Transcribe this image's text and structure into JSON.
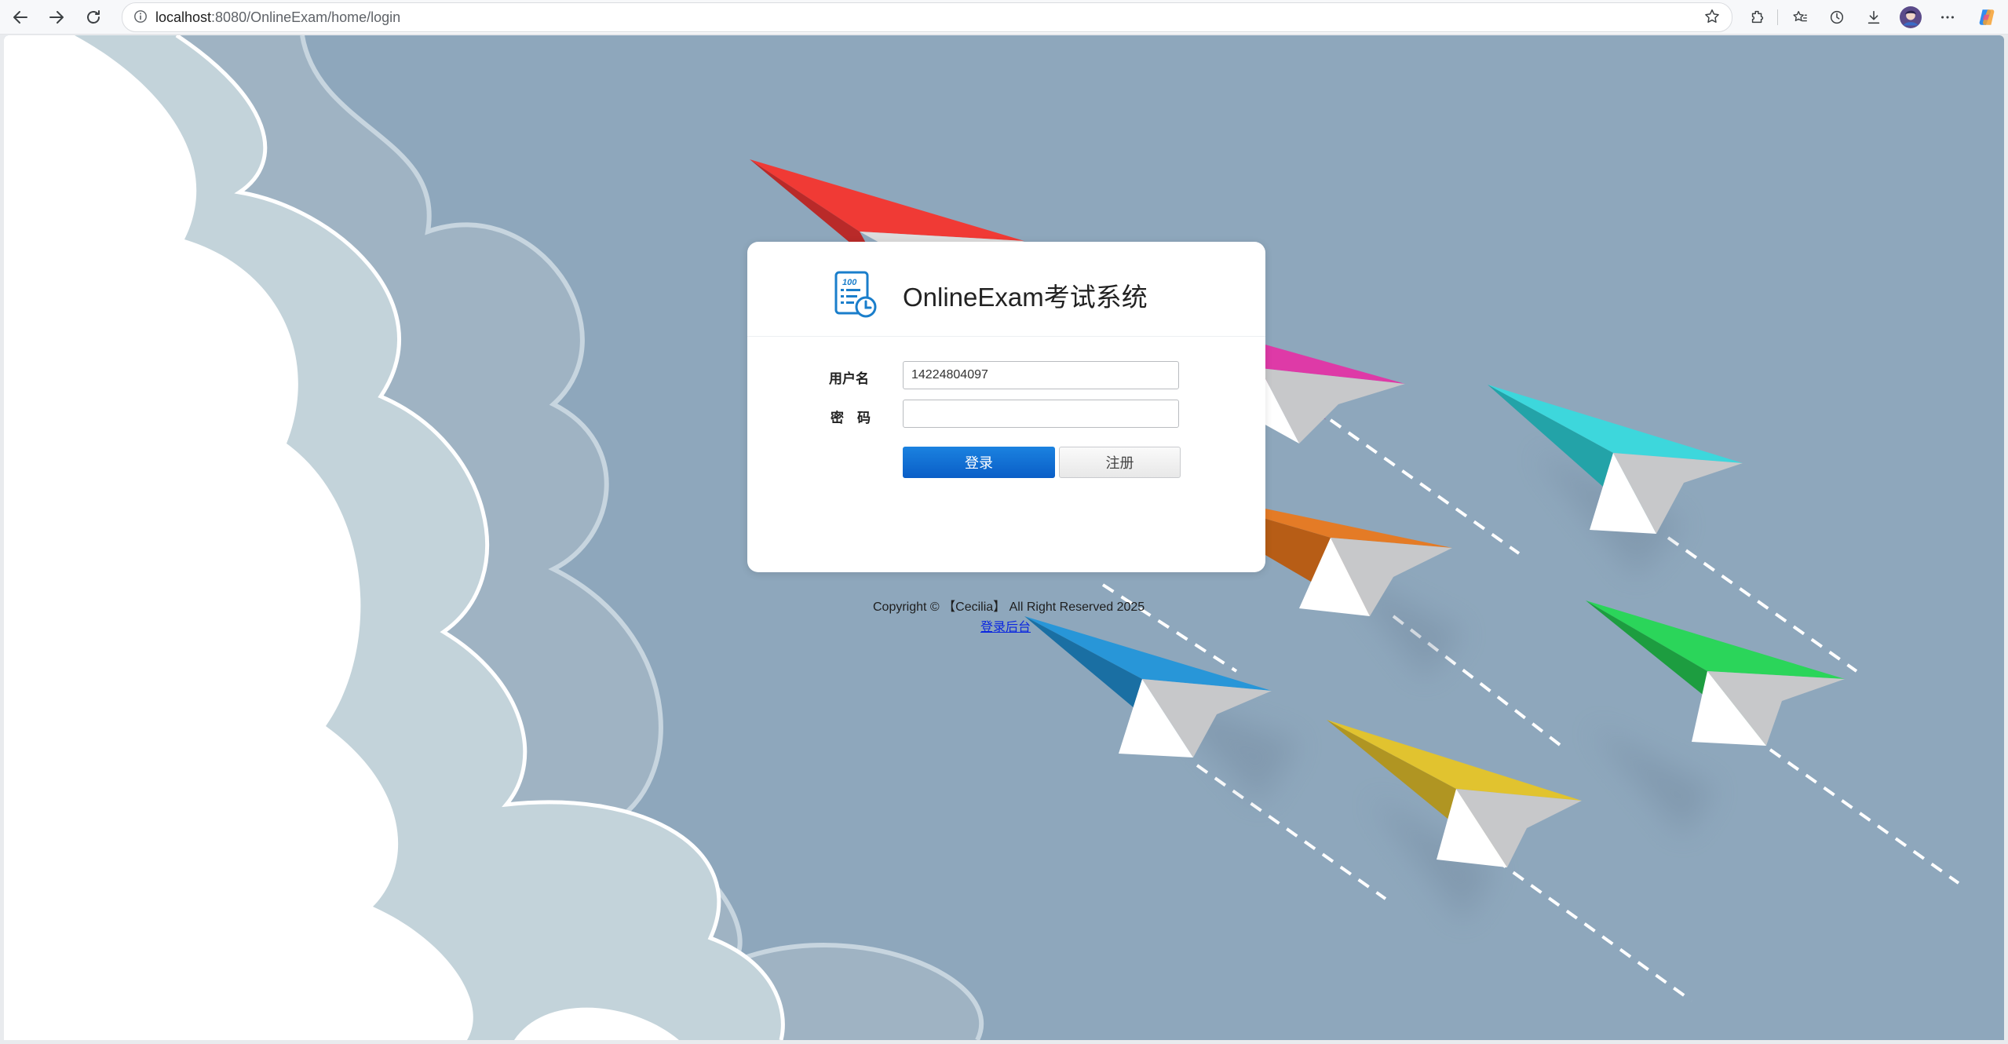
{
  "browser": {
    "url_host": "localhost",
    "url_path": ":8080/OnlineExam/home/login"
  },
  "login": {
    "app_title": "OnlineExam考试系统",
    "username_label": "用户名",
    "password_label": "密　码",
    "username_value": "14224804097",
    "password_value": "",
    "login_button": "登录",
    "register_button": "注册"
  },
  "footer": {
    "copyright": "Copyright © 【Cecilia】 All Right Reserved 2025",
    "admin_link": "登录后台"
  },
  "colors": {
    "sky": "#8ea7bc",
    "primary_button": "#0a5ec7",
    "link": "#0a26e0"
  }
}
